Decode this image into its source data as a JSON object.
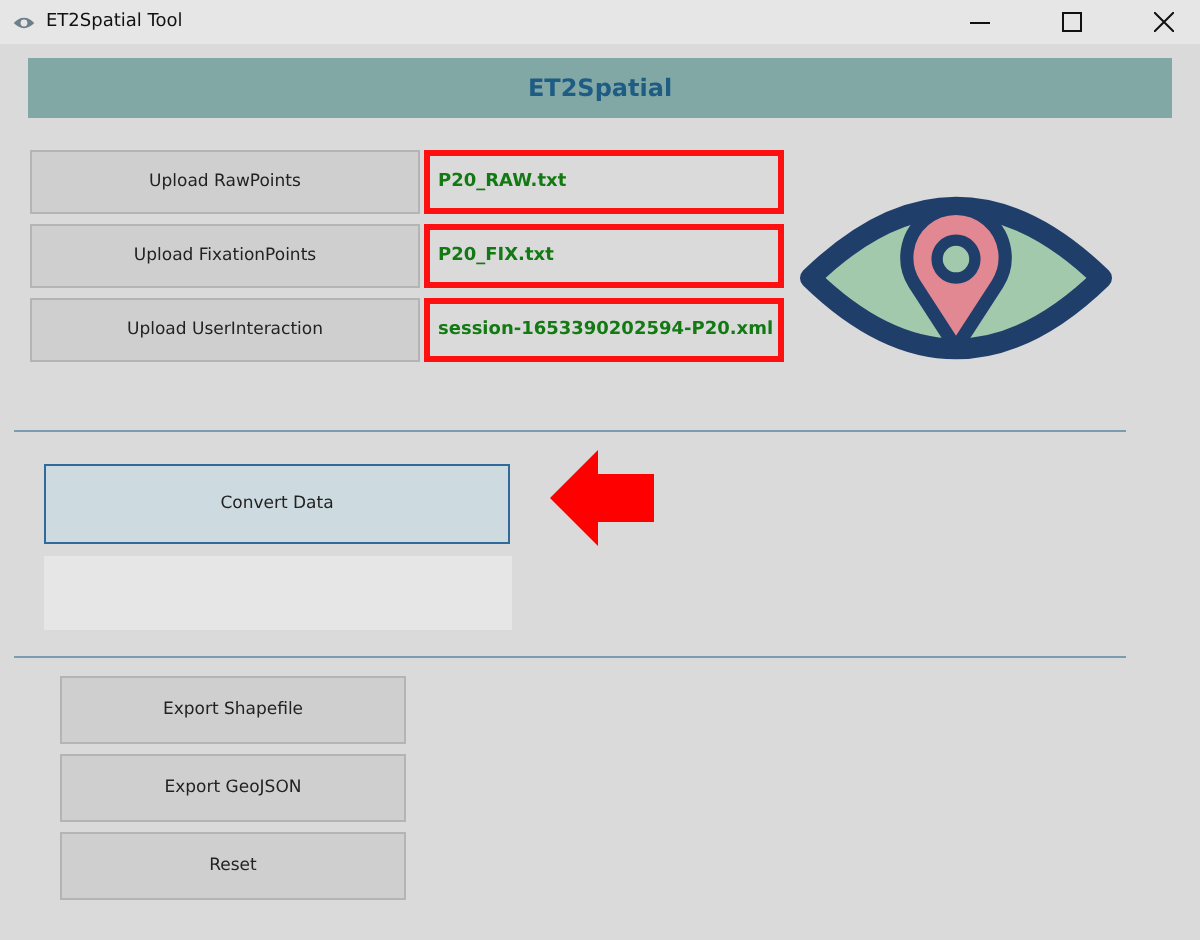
{
  "window": {
    "title": "ET2Spatial Tool"
  },
  "banner": {
    "title": "ET2Spatial"
  },
  "uploads": [
    {
      "button": "Upload RawPoints",
      "file": "P20_RAW.txt"
    },
    {
      "button": "Upload FixationPoints",
      "file": "P20_FIX.txt"
    },
    {
      "button": "Upload UserInteraction",
      "file": "session-1653390202594-P20.xml"
    }
  ],
  "convert": {
    "label": "Convert Data",
    "focused": true
  },
  "exports": [
    {
      "label": "Export Shapefile"
    },
    {
      "label": "Export GeoJSON"
    },
    {
      "label": "Reset"
    }
  ]
}
